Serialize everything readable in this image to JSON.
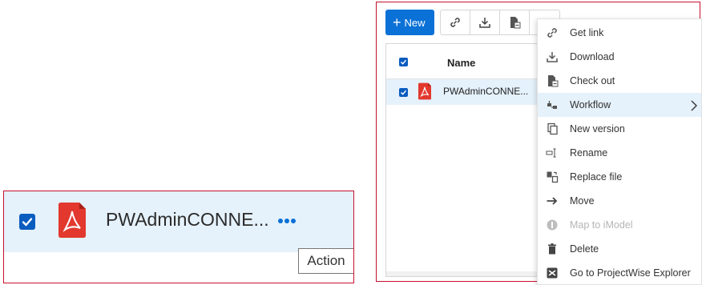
{
  "zoom": {
    "file_name": "PWAdminCONNE...",
    "tooltip": "Action"
  },
  "toolbar": {
    "new_label": "New",
    "icons": [
      "link-icon",
      "download-icon",
      "check-out-icon",
      "more-icon"
    ]
  },
  "list": {
    "header_name": "Name",
    "rows": [
      {
        "name": "PWAdminCONNE...",
        "selected": true,
        "type": "pdf"
      }
    ]
  },
  "context_menu": {
    "items": [
      {
        "label": "Get link",
        "icon": "link-icon",
        "enabled": true
      },
      {
        "label": "Download",
        "icon": "download-icon",
        "enabled": true
      },
      {
        "label": "Check out",
        "icon": "check-out-icon",
        "enabled": true
      },
      {
        "label": "Workflow",
        "icon": "workflow-icon",
        "enabled": true,
        "submenu": true,
        "highlighted": true
      },
      {
        "label": "New version",
        "icon": "new-version-icon",
        "enabled": true
      },
      {
        "label": "Rename",
        "icon": "rename-icon",
        "enabled": true
      },
      {
        "label": "Replace file",
        "icon": "replace-file-icon",
        "enabled": true
      },
      {
        "label": "Move",
        "icon": "arrow-right-icon",
        "enabled": true
      },
      {
        "label": "Map to iModel",
        "icon": "imodel-icon",
        "enabled": false
      },
      {
        "label": "Delete",
        "icon": "trash-icon",
        "enabled": true
      },
      {
        "label": "Go to ProjectWise Explorer",
        "icon": "explorer-icon",
        "enabled": true
      }
    ]
  },
  "colors": {
    "accent": "#0a71d6",
    "selection": "#e5f1fb",
    "annotation_border": "#c8102e",
    "pdf_red": "#e2382e"
  }
}
